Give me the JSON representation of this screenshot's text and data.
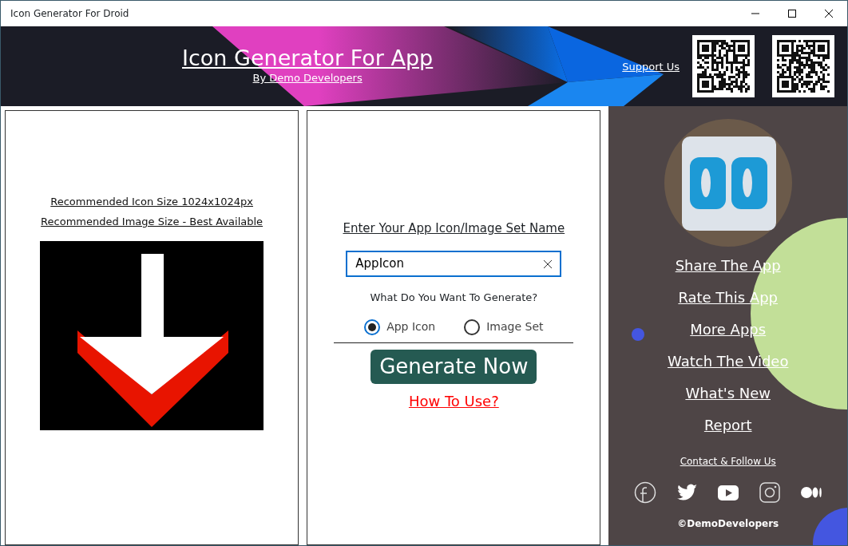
{
  "window": {
    "title": "Icon Generator For Droid"
  },
  "header": {
    "title": "Icon Generator For App",
    "subtitle": "By Demo Developers",
    "support_link": "Support Us"
  },
  "preview": {
    "lines": [
      "Recommended Icon Size 1024x1024px",
      "Recommended Image Size - Best Available"
    ]
  },
  "form": {
    "label": "Enter Your App Icon/Image Set Name",
    "name_value": "AppIcon",
    "question": "What Do You Want To Generate?",
    "options": [
      {
        "label": "App Icon",
        "selected": true
      },
      {
        "label": "Image Set",
        "selected": false
      }
    ],
    "button": "Generate Now",
    "help_link": "How To Use?"
  },
  "sidebar": {
    "links": [
      "Share The App",
      "Rate This App",
      "More Apps",
      "Watch The Video",
      "What's New",
      "Report"
    ],
    "contact": "Contact & Follow Us",
    "socials": [
      {
        "kind": "facebook"
      },
      {
        "kind": "twitter"
      },
      {
        "kind": "youtube"
      },
      {
        "kind": "instagram"
      },
      {
        "kind": "medium"
      }
    ],
    "copyright": "©DemoDevelopers"
  }
}
